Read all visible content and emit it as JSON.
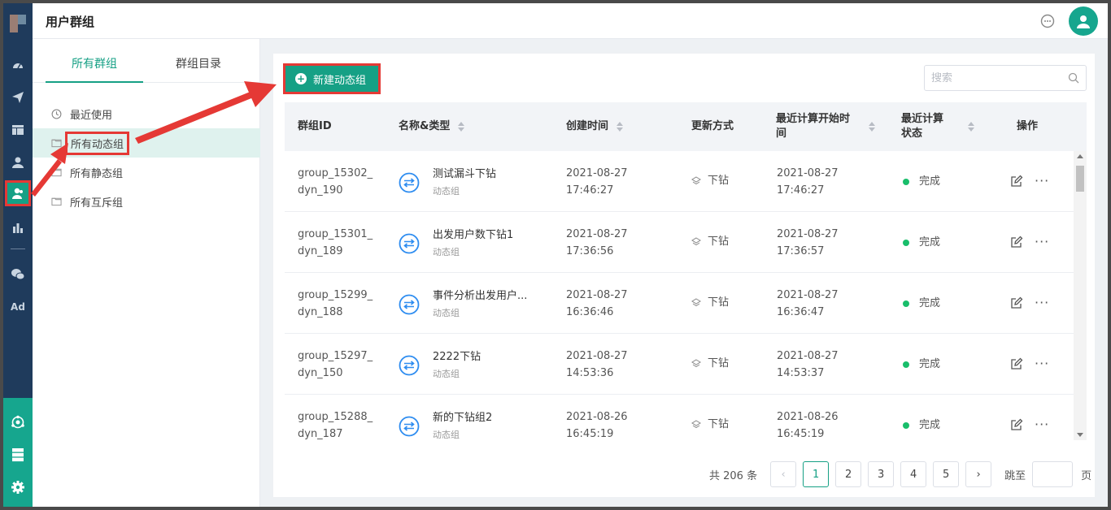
{
  "header": {
    "title": "用户群组"
  },
  "sidebar_tabs": [
    {
      "label": "所有群组"
    },
    {
      "label": "群组目录"
    }
  ],
  "nav": [
    {
      "label": "最近使用",
      "icon": "clock-icon"
    },
    {
      "label": "所有动态组",
      "icon": "folder-icon"
    },
    {
      "label": "所有静态组",
      "icon": "folder-icon"
    },
    {
      "label": "所有互斥组",
      "icon": "folder-icon"
    }
  ],
  "rail": {
    "ad_label": "Ad"
  },
  "toolbar": {
    "new_button": "新建动态组",
    "search_placeholder": "搜索"
  },
  "table": {
    "columns": [
      "群组ID",
      "名称&类型",
      "创建时间",
      "更新方式",
      "最近计算开始时间",
      "最近计算状态",
      "操作"
    ],
    "col_lines": {
      "last_calc_1": "最近计算开始时",
      "last_calc_2": "间",
      "state_1": "最近计算",
      "state_2": "状态"
    },
    "rows": [
      {
        "id1": "group_15302_",
        "id2": "dyn_190",
        "name": "测试漏斗下钻",
        "type": "动态组",
        "cdate": "2021-08-27",
        "ctime": "17:46:27",
        "update": "下钻",
        "ldate": "2021-08-27",
        "ltime": "17:46:27",
        "status": "完成"
      },
      {
        "id1": "group_15301_",
        "id2": "dyn_189",
        "name": "出发用户数下钻1",
        "type": "动态组",
        "cdate": "2021-08-27",
        "ctime": "17:36:56",
        "update": "下钻",
        "ldate": "2021-08-27",
        "ltime": "17:36:57",
        "status": "完成"
      },
      {
        "id1": "group_15299_",
        "id2": "dyn_188",
        "name": "事件分析出发用户...",
        "type": "动态组",
        "cdate": "2021-08-27",
        "ctime": "16:36:46",
        "update": "下钻",
        "ldate": "2021-08-27",
        "ltime": "16:36:47",
        "status": "完成"
      },
      {
        "id1": "group_15297_",
        "id2": "dyn_150",
        "name": "2222下钻",
        "type": "动态组",
        "cdate": "2021-08-27",
        "ctime": "14:53:36",
        "update": "下钻",
        "ldate": "2021-08-27",
        "ltime": "14:53:37",
        "status": "完成"
      },
      {
        "id1": "group_15288_",
        "id2": "dyn_187",
        "name": "新的下钻组2",
        "type": "动态组",
        "cdate": "2021-08-26",
        "ctime": "16:45:19",
        "update": "下钻",
        "ldate": "2021-08-26",
        "ltime": "16:45:19",
        "status": "完成"
      }
    ]
  },
  "pagination": {
    "total": "共 206 条",
    "pages": [
      "1",
      "2",
      "3",
      "4",
      "5"
    ],
    "current": "1",
    "jump_label": "跳至",
    "page_suffix": "页"
  },
  "colors": {
    "accent": "#16a085",
    "rail": "#1f3b5c",
    "highlight": "#e53935",
    "success": "#19be6b"
  }
}
